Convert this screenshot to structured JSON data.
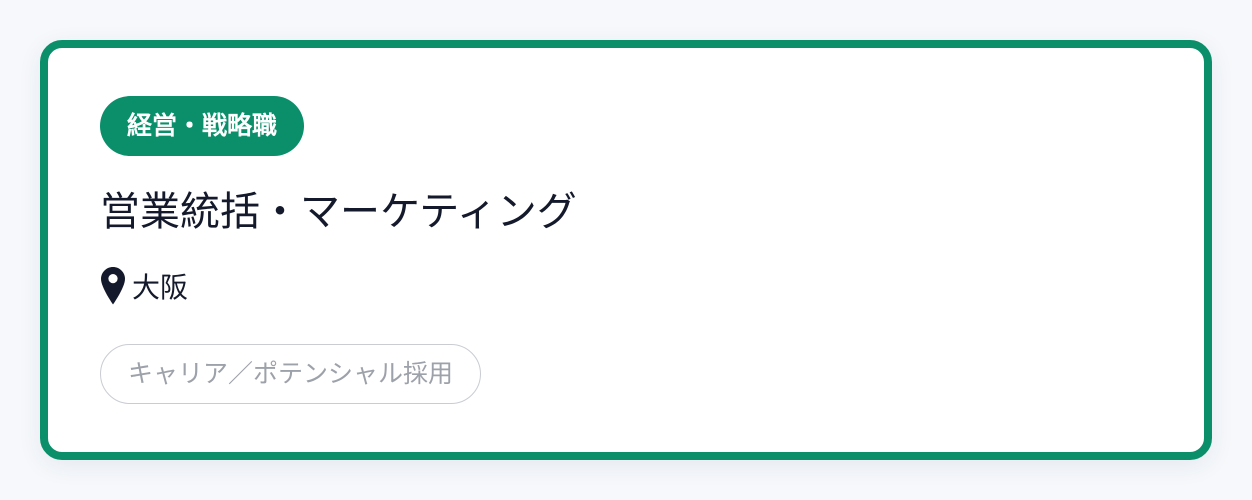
{
  "card": {
    "category": "経営・戦略職",
    "title": "営業統括・マーケティング",
    "location": "大阪",
    "hiring_type": "キャリア／ポテンシャル採用",
    "location_icon": "map-pin-icon"
  },
  "colors": {
    "accent": "#0a8f6a",
    "title_text": "#141a2b",
    "tag_text": "#9da1aa",
    "tag_border": "#c9ccd3",
    "background": "#f6f8fb"
  }
}
